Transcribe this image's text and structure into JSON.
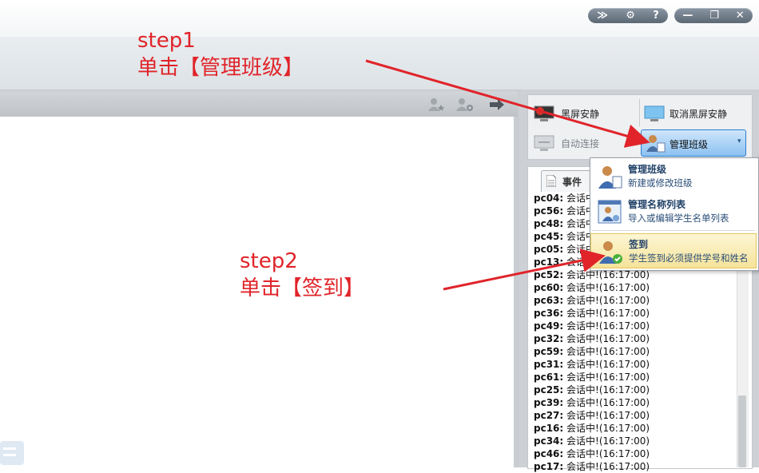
{
  "window_controls": {
    "collapse": "≫",
    "settings": "⚙",
    "help": "?",
    "minimize": "—",
    "restore": "❐",
    "close": "✕"
  },
  "toolbar_right": {
    "black_screen": "黑屏安静",
    "cancel_black_screen": "取消黑屏安静",
    "auto_connect": "自动连接",
    "manage_class": "管理班级"
  },
  "event_tab": {
    "label": "事件"
  },
  "events": [
    {
      "pc": "pc04:",
      "text": "会话中"
    },
    {
      "pc": "pc56:",
      "text": "会话中"
    },
    {
      "pc": "pc48:",
      "text": "会话中"
    },
    {
      "pc": "pc45:",
      "text": "会话中"
    },
    {
      "pc": "pc05:",
      "text": "会话中"
    },
    {
      "pc": "pc13:",
      "text": "会话中"
    },
    {
      "pc": "pc52:",
      "text": "会话中!(16:17:00)"
    },
    {
      "pc": "pc60:",
      "text": "会话中!(16:17:00)"
    },
    {
      "pc": "pc63:",
      "text": "会话中!(16:17:00)"
    },
    {
      "pc": "pc36:",
      "text": "会话中!(16:17:00)"
    },
    {
      "pc": "pc49:",
      "text": "会话中!(16:17:00)"
    },
    {
      "pc": "pc32:",
      "text": "会话中!(16:17:00)"
    },
    {
      "pc": "pc59:",
      "text": "会话中!(16:17:00)"
    },
    {
      "pc": "pc31:",
      "text": "会话中!(16:17:00)"
    },
    {
      "pc": "pc61:",
      "text": "会话中!(16:17:00)"
    },
    {
      "pc": "pc25:",
      "text": "会话中!(16:17:00)"
    },
    {
      "pc": "pc39:",
      "text": "会话中!(16:17:00)"
    },
    {
      "pc": "pc27:",
      "text": "会话中!(16:17:00)"
    },
    {
      "pc": "pc16:",
      "text": "会话中!(16:17:00)"
    },
    {
      "pc": "pc34:",
      "text": "会话中!(16:17:00)"
    },
    {
      "pc": "pc46:",
      "text": "会话中!(16:17:00)"
    },
    {
      "pc": "pc17:",
      "text": "会话中!(16:17:00)"
    }
  ],
  "menu": {
    "items": [
      {
        "title": "管理班级",
        "desc": "新建或修改班级"
      },
      {
        "title": "管理名称列表",
        "desc": "导入或编辑学生名单列表"
      },
      {
        "title": "签到",
        "desc": "学生签到必须提供学号和姓名"
      }
    ]
  },
  "annotations": {
    "step1_title": "step1",
    "step1_text": "单击【管理班级】",
    "step2_title": "step2",
    "step2_text": "单击【签到】"
  },
  "colors": {
    "annotation": "#e0242a",
    "accent_blue": "#2f7fd0"
  }
}
